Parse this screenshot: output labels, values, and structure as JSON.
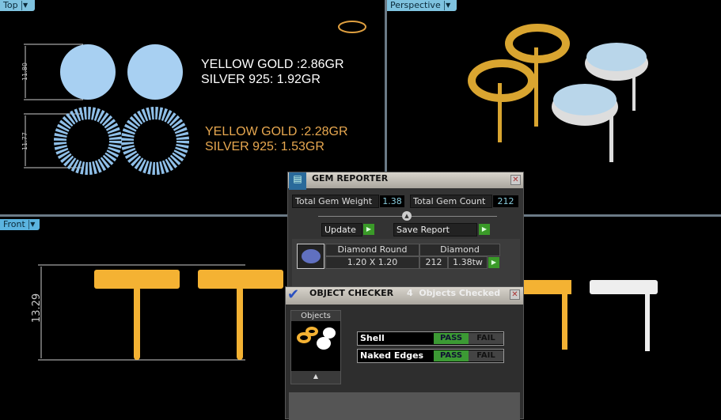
{
  "viewports": {
    "top": {
      "label": "Top",
      "dim_top": "11.80",
      "dim_bottom": "11.77",
      "weights_solid": [
        "YELLOW GOLD :2.86GR",
        "SILVER 925: 1.92GR"
      ],
      "weights_ring": [
        "YELLOW GOLD :2.28GR",
        "SILVER 925: 1.53GR"
      ]
    },
    "perspective": {
      "label": "Perspective"
    },
    "front": {
      "label": "Front",
      "dim": "13.29"
    }
  },
  "gem_reporter": {
    "title": "GEM REPORTER",
    "weight_label": "Total Gem Weight",
    "weight_value": "1.38",
    "count_label": "Total Gem Count",
    "count_value": "212",
    "update_label": "Update",
    "save_label": "Save Report",
    "gem": {
      "shape": "Diamond Round",
      "size": "1.20 X 1.20",
      "material": "Diamond",
      "count": "212",
      "weight": "1.38tw"
    }
  },
  "object_checker": {
    "title": "OBJECT CHECKER",
    "status": "4  Objects Checked",
    "objects_label": "Objects",
    "checks": [
      {
        "name": "Shell",
        "pass": "PASS",
        "fail": "FAIL",
        "result": "pass"
      },
      {
        "name": "Naked Edges",
        "pass": "PASS",
        "fail": "FAIL",
        "result": "pass"
      }
    ]
  },
  "colors": {
    "gold": "#f4b233",
    "silver": "#e8e8e8",
    "pass": "#3c9a34",
    "tab": "#7fc3e0"
  }
}
